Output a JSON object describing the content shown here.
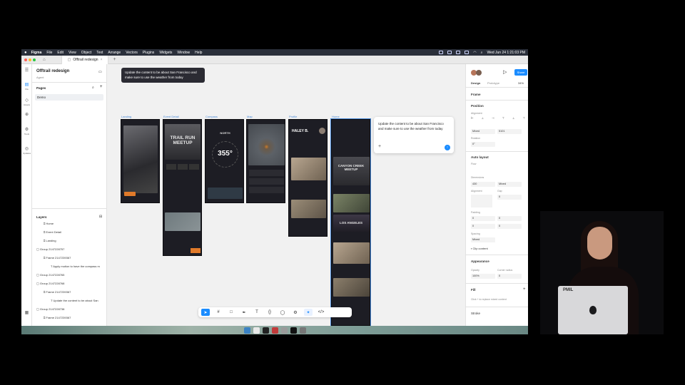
{
  "menubar": {
    "app": "Figma",
    "items": [
      "File",
      "Edit",
      "View",
      "Object",
      "Text",
      "Arrange",
      "Vectors",
      "Plugins",
      "Widgets",
      "Window",
      "Help"
    ],
    "datetime": "Wed Jun 24 1:21:03 PM"
  },
  "tabbar": {
    "tab_label": "Offtrail redesign",
    "plus": "+"
  },
  "rail": {
    "file": "File",
    "assets": "Assets",
    "tools": "Tools",
    "updates": "Updates"
  },
  "left_panel": {
    "file_title": "Offtrail redesign",
    "file_sub": "Agent",
    "pages_title": "Pages",
    "pages": [
      "Demo"
    ],
    "layers_title": "Layers",
    "layers": [
      "Home",
      "Event Detail",
      "Landing",
      "Group 2147228757",
      "Frame 2147239367",
      "Apply motion to have the compass m",
      "Group 2147228765",
      "Group 2147228768",
      "Frame 2147239367",
      "Update the content to be about San",
      "Group 2147228738",
      "Frame 2147239367",
      "For all colors and text, attach the clo",
      "Group 2147228745",
      "Frame 2147239367",
      "Use these designs as references to g",
      "Profile",
      "Home"
    ]
  },
  "canvas": {
    "tooltip": "Update the content to be about San Francisco and make sure to use the weather from today",
    "frames": [
      "Landing",
      "Event Detail",
      "Compass",
      "Map",
      "Profile",
      "Home"
    ],
    "compass_title": "NORTH",
    "compass_value": "355°",
    "event_title": "TRAIL RUN MEETUP",
    "profile_name": "HALEY B.",
    "home_card": "CANYON CREEK MEETUP",
    "home_card2": "LOS ANGELES",
    "popup_text": "Update the content to be about San Francisco and make sure to use the weather from today",
    "popup_plus": "+"
  },
  "toolbar": {
    "items": [
      "move",
      "frame",
      "shape",
      "pen",
      "text",
      "comment",
      "actions",
      "dev-mode"
    ]
  },
  "right_panel": {
    "share": "Share",
    "tab_design": "Design",
    "tab_prototype": "Prototype",
    "zoom": "34%",
    "frame_label": "Frame",
    "position": "Position",
    "alignment": "Alignment",
    "position_x": "Mixed",
    "position_y": "5101",
    "rotation_label": "Rotation",
    "rotation": "0°",
    "auto_layout": "Auto layout",
    "flow": "Flow",
    "dimensions": "Dimensions",
    "width": "430",
    "height": "Mixed",
    "alignment2": "Alignment",
    "gap": "Gap",
    "gap_value": "0",
    "padding": "Padding",
    "pad1": "0",
    "pad2": "0",
    "pad3": "0",
    "pad4": "0",
    "spacing": "Spacing",
    "spacing_value": "Mixed",
    "clip": "Clip content",
    "appearance": "Appearance",
    "opacity_label": "Opacity",
    "opacity": "100%",
    "corner_label": "Corner radius",
    "corner": "0",
    "fill": "Fill",
    "fill_hint": "Click + to replace mixed content",
    "stroke": "Stroke"
  },
  "presenter": {
    "sticker": "PMIL"
  },
  "colors": {
    "accent": "#1a8cff",
    "frame_label": "#4a8ad8",
    "phone_bg": "#1d1d24",
    "tooltip_bg": "#2b2b33"
  }
}
